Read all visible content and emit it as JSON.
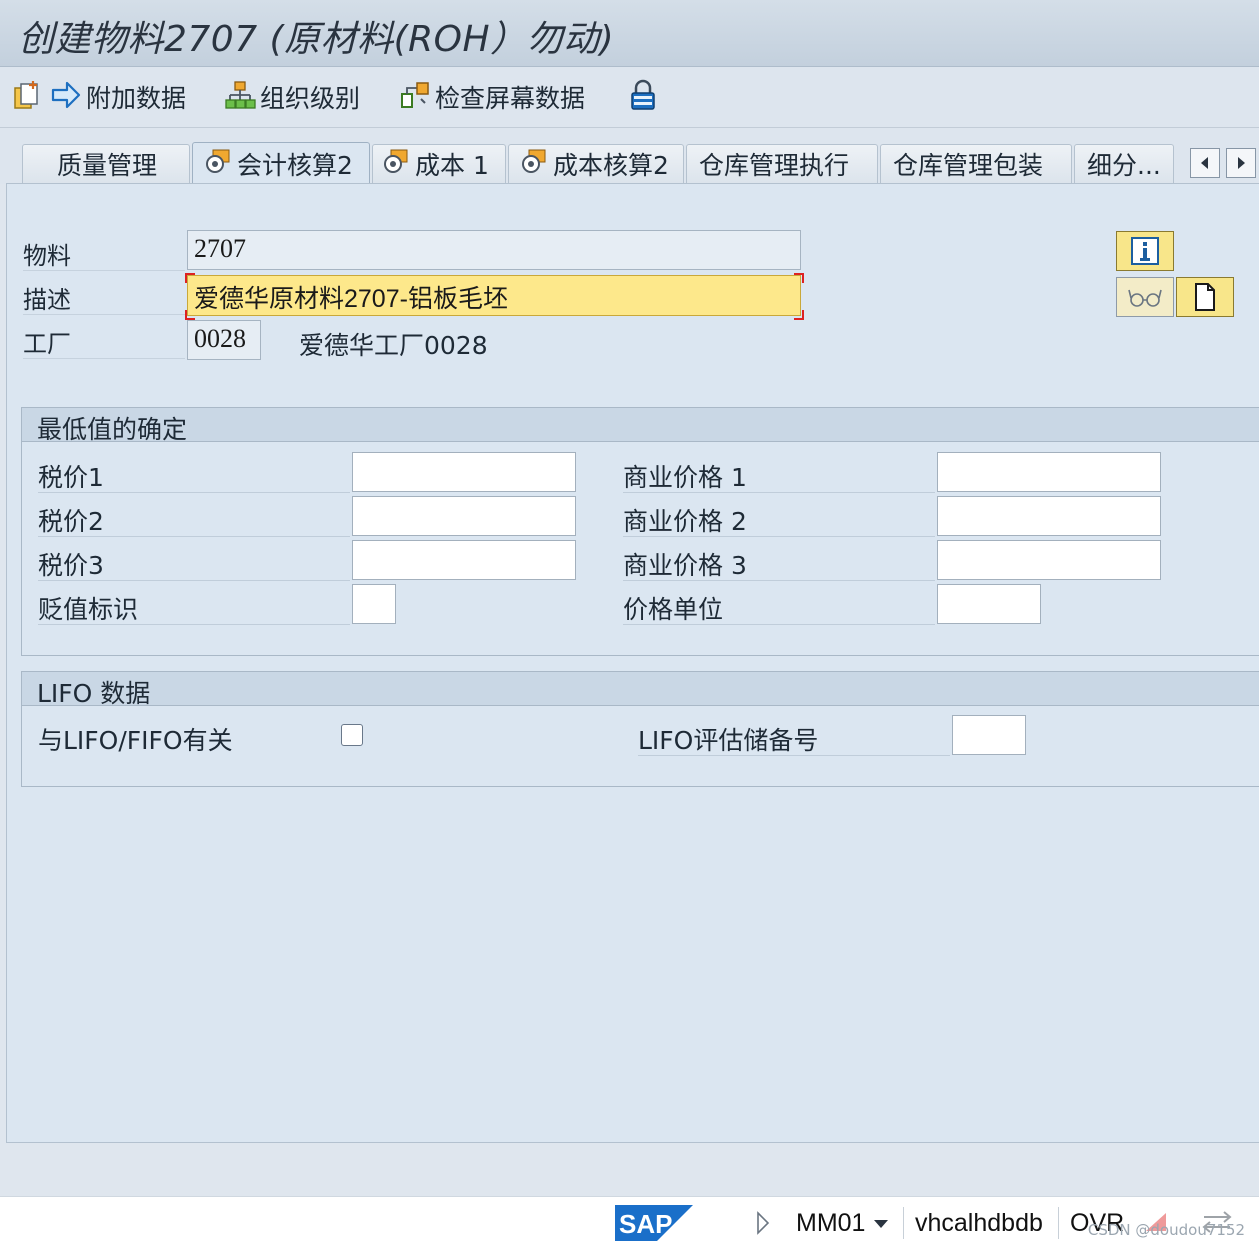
{
  "window": {
    "title": "创建物料2707 (原材料(ROH）勿动)"
  },
  "toolbar": {
    "items": [
      {
        "icon": "new-entry-icon",
        "label": ""
      },
      {
        "icon": "arrow-right-icon",
        "label": "附加数据"
      },
      {
        "icon": "org-hierarchy-icon",
        "label": "组织级别"
      },
      {
        "icon": "check-screen-icon",
        "label": "检查屏幕数据"
      },
      {
        "icon": "lock-icon",
        "label": ""
      }
    ]
  },
  "tabs": [
    {
      "label": "质量管理",
      "icon": ""
    },
    {
      "label": "会计核算2",
      "icon": "settings-folder-icon",
      "active": true
    },
    {
      "label": "成本 1",
      "icon": "settings-folder-icon"
    },
    {
      "label": "成本核算2",
      "icon": "settings-folder-icon"
    },
    {
      "label": "仓库管理执行",
      "icon": ""
    },
    {
      "label": "仓库管理包装",
      "icon": ""
    },
    {
      "label": "细分...",
      "icon": ""
    }
  ],
  "header": {
    "material_label": "物料",
    "material_value": "2707",
    "description_label": "描述",
    "description_value": "爱德华原材料2707-铝板毛坯",
    "plant_label": "工厂",
    "plant_value": "0028",
    "plant_name": "爱德华工厂0028"
  },
  "lowest_value": {
    "title": "最低值的确定",
    "left": [
      {
        "label": "税价1",
        "value": ""
      },
      {
        "label": "税价2",
        "value": ""
      },
      {
        "label": "税价3",
        "value": ""
      },
      {
        "label": "贬值标识",
        "value": ""
      }
    ],
    "right": [
      {
        "label": "商业价格 1",
        "value": ""
      },
      {
        "label": "商业价格 2",
        "value": ""
      },
      {
        "label": "商业价格 3",
        "value": ""
      },
      {
        "label": "价格单位",
        "value": ""
      }
    ]
  },
  "lifo": {
    "title": "LIFO 数据",
    "relevant_label": "与LIFO/FIFO有关",
    "relevant_checked": false,
    "pool_label": "LIFO评估储备号",
    "pool_value": ""
  },
  "statusbar": {
    "logo": "SAP",
    "transaction": "MM01",
    "system": "vhcalhdbdb",
    "mode": "OVR",
    "watermark": "CSDN @doudou7152"
  },
  "colors": {
    "focus_field": "#fde88b",
    "panel": "#dbe6f1",
    "group_header": "#c9d7e5",
    "sap_blue": "#1a6fc9"
  }
}
